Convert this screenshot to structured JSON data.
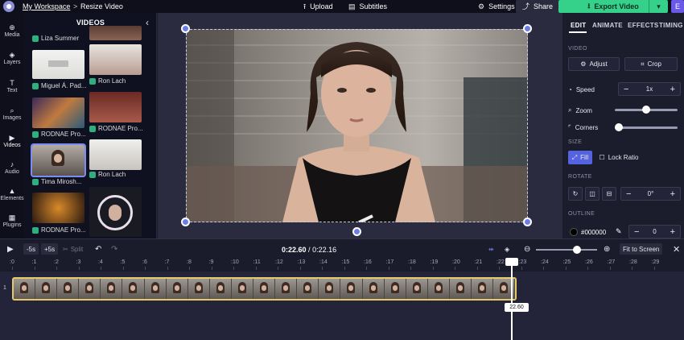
{
  "topbar": {
    "workspace": "My Workspace",
    "separator": ">",
    "title": "Resize Video",
    "upload": "Upload",
    "subtitles": "Subtitles",
    "settings": "Settings",
    "share": "Share",
    "export": "Export Video",
    "avatar": "E"
  },
  "nav": [
    "Media",
    "Layers",
    "Text",
    "Images",
    "Videos",
    "Audio",
    "Elements",
    "Plugins"
  ],
  "videos": {
    "title": "VIDEOS",
    "items": [
      {
        "label": "Liza Summer"
      },
      {
        "label": "Miguel Á. Pad..."
      },
      {
        "label": "Ron Lach"
      },
      {
        "label": "RODNAE Pro..."
      },
      {
        "label": "RODNAE Pro..."
      },
      {
        "label": "Tima Mirosh..."
      },
      {
        "label": "Ron Lach"
      },
      {
        "label": "RODNAE Pro..."
      }
    ]
  },
  "right": {
    "tabs": [
      "EDIT",
      "ANIMATE",
      "EFFECTS",
      "TIMING"
    ],
    "video_section": "VIDEO",
    "adjust": "Adjust",
    "crop": "Crop",
    "speed": "Speed",
    "speed_value": "1x",
    "zoom": "Zoom",
    "zoom_level": 0.5,
    "corners": "Corners",
    "corners_level": 0.0,
    "size_section": "SIZE",
    "fill": "Fill",
    "lock_ratio": "Lock Ratio",
    "rotate_section": "ROTATE",
    "rotate_value": "0°",
    "outline_section": "OUTLINE",
    "outline_color": "#000000",
    "outline_value": "0"
  },
  "timeline": {
    "back5": "-5s",
    "fwd5": "+5s",
    "split": "Split",
    "current_time": "0:22.60",
    "total_time": "0:22.16",
    "fit": "Fit to Screen",
    "ticks": [
      ":0",
      ":1",
      ":2",
      ":3",
      ":4",
      ":5",
      ":6",
      ":7",
      ":8",
      ":9",
      ":10",
      ":11",
      ":12",
      ":13",
      ":14",
      ":15",
      ":16",
      ":17",
      ":18",
      ":19",
      ":20",
      ":21",
      ":22",
      ":23",
      ":24",
      ":25",
      ":26",
      ":27",
      ":28",
      ":29"
    ],
    "track_number": "1",
    "playhead_label": "22.60"
  },
  "colors": {
    "accent": "#6b7ee8",
    "export_green": "#35d08a",
    "clip_border": "#e6c968"
  }
}
